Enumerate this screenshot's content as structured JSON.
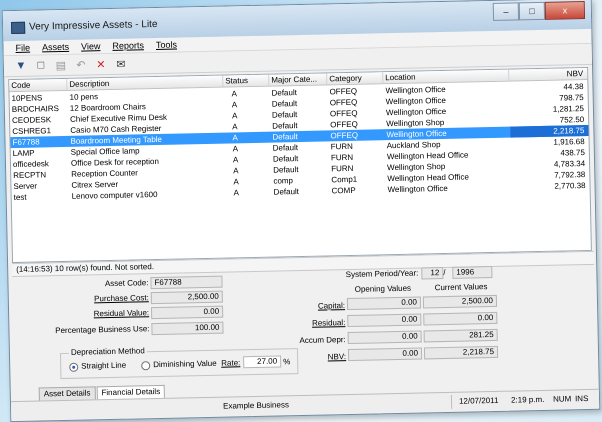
{
  "window": {
    "title": "Very Impressive Assets - Lite",
    "min": "–",
    "max": "□",
    "close": "x"
  },
  "menu": [
    "File",
    "Assets",
    "View",
    "Reports",
    "Tools"
  ],
  "toolbar": {
    "icons": [
      "open-icon",
      "new-document-icon",
      "save-icon",
      "undo-icon",
      "delete-icon",
      "print-icon"
    ],
    "glyphs": [
      "▼",
      "□",
      "▤",
      "↶",
      "✕",
      "✉"
    ]
  },
  "table": {
    "columns": [
      "Code",
      "Description",
      "Status",
      "Major Cate...",
      "Category",
      "Location",
      "NBV"
    ],
    "rows": [
      [
        "10PENS",
        "10 pens",
        "A",
        "Default",
        "OFFEQ",
        "Wellington Office",
        "44.38"
      ],
      [
        "BRDCHAIRS",
        "12 Boardroom Chairs",
        "A",
        "Default",
        "OFFEQ",
        "Wellington Office",
        "798.75"
      ],
      [
        "CEODESK",
        "Chief Executive Rimu Desk",
        "A",
        "Default",
        "OFFEQ",
        "Wellington Office",
        "1,281.25"
      ],
      [
        "CSHREG1",
        "Casio M70 Cash Register",
        "A",
        "Default",
        "OFFEQ",
        "Wellington Shop",
        "752.50"
      ],
      [
        "F67788",
        "Boardroom Meeting Table",
        "A",
        "Default",
        "OFFEQ",
        "Wellington Office",
        "2,218.75"
      ],
      [
        "LAMP",
        "Special Office lamp",
        "A",
        "Default",
        "FURN",
        "Auckland Shop",
        "1,916.68"
      ],
      [
        "officedesk",
        "Office Desk for reception",
        "A",
        "Default",
        "FURN",
        "Wellington Head Office",
        "438.75"
      ],
      [
        "RECPTN",
        "Reception Counter",
        "A",
        "Default",
        "FURN",
        "Wellington Shop",
        "4,783.34"
      ],
      [
        "Server",
        "Citrex Server",
        "A",
        "comp",
        "Comp1",
        "Wellington Head Office",
        "7,792.38"
      ],
      [
        "test",
        "Lenovo computer v1600",
        "A",
        "Default",
        "COMP",
        "Wellington Office",
        "2,770.38"
      ]
    ],
    "selected_index": 4
  },
  "status_message": "(14:16:53) 10 row(s) found. Not sorted.",
  "form": {
    "asset_code_label": "Asset Code:",
    "asset_code": "F67788",
    "purchase_cost_label": "Purchase Cost:",
    "purchase_cost": "2,500.00",
    "residual_value_label": "Residual Value:",
    "residual_value": "0.00",
    "pct_business_label": "Percentage Business Use:",
    "pct_business": "100.00",
    "dep_method_title": "Depreciation Method",
    "straight_line": "Straight Line",
    "diminishing_value": "Diminishing Value",
    "rate_label": "Rate:",
    "rate": "27.00",
    "rate_unit": "%",
    "system_period_label": "System Period/Year:",
    "period": "12",
    "period_sep": "/",
    "year": "1996",
    "opening_values_label": "Opening Values",
    "current_values_label": "Current Values",
    "capital_label": "Capital:",
    "capital_open": "0.00",
    "capital_current": "2,500.00",
    "residual_label": "Residual:",
    "residual_open": "0.00",
    "residual_current": "0.00",
    "accum_label": "Accum Depr:",
    "accum_open": "0.00",
    "accum_current": "281.25",
    "nbv_label": "NBV:",
    "nbv_open": "0.00",
    "nbv_current": "2,218.75"
  },
  "tabs": [
    "Asset Details",
    "Financial Details"
  ],
  "statusbar": {
    "business": "Example Business",
    "date": "12/07/2011",
    "time": "2:19 p.m.",
    "num": "NUM",
    "ins": "INS"
  }
}
